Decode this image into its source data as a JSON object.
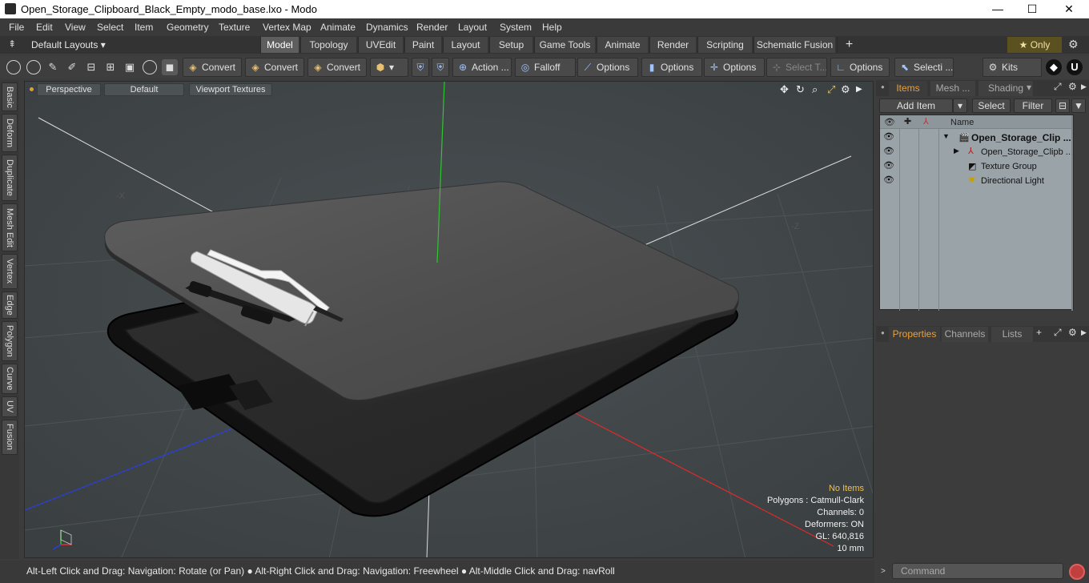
{
  "window": {
    "title": "Open_Storage_Clipboard_Black_Empty_modo_base.lxo - Modo",
    "minimize": "—",
    "maximize": "☐",
    "close": "✕"
  },
  "menu": [
    "File",
    "Edit",
    "View",
    "Select",
    "Item",
    "Geometry",
    "Texture",
    "Vertex Map",
    "Animate",
    "Dynamics",
    "Render",
    "Layout",
    "System",
    "Help"
  ],
  "layouts": {
    "label": "Default Layouts ▾",
    "tabs": [
      "Model",
      "Topology",
      "UVEdit",
      "Paint",
      "Layout",
      "Setup",
      "Game Tools",
      "Animate",
      "Render",
      "Scripting",
      "Schematic Fusion"
    ],
    "active_tab": "Model",
    "add": "+",
    "only_label": "★  Only"
  },
  "toolbar": {
    "convert_1": "Convert",
    "convert_2": "Convert",
    "convert_3": "Convert",
    "action": "Action ...",
    "falloff": "Falloff",
    "options_1": "Options",
    "options_2": "Options",
    "options_3": "Options",
    "select_t": "Select T...",
    "options_4": "Options",
    "selecti": "Selecti ...",
    "kits": "Kits"
  },
  "left_tabs": [
    "Basic",
    "Deform",
    "Duplicate",
    "Mesh Edit",
    "Vertex",
    "Edge",
    "Polygon",
    "Curve",
    "UV",
    "Fusion"
  ],
  "viewport": {
    "perspective": "Perspective",
    "default": "Default",
    "textures": "Viewport Textures",
    "axis_neg_x": "-X",
    "axis_neg_z": "-Z",
    "stats": {
      "no_items": "No Items",
      "polygons": "Polygons : Catmull-Clark",
      "channels": "Channels: 0",
      "deformers": "Deformers: ON",
      "gl": "GL: 640,816",
      "scale": "10 mm"
    }
  },
  "status": "Alt-Left Click and Drag: Navigation: Rotate (or Pan) ● Alt-Right Click and Drag: Navigation: Freewheel ● Alt-Middle Click and Drag: navRoll",
  "items_panel": {
    "tabs": [
      "Items",
      "Mesh ...",
      "Shading"
    ],
    "active_tab": "Items",
    "add_item": "Add Item",
    "select": "Select",
    "filter": "Filter",
    "name_header": "Name",
    "rows": [
      {
        "label": "Open_Storage_Clip ..."
      },
      {
        "label": "Open_Storage_Clipb ..."
      },
      {
        "label": "Texture Group"
      },
      {
        "label": "Directional Light"
      }
    ]
  },
  "properties_panel": {
    "tabs": [
      "Properties",
      "Channels",
      "Lists"
    ],
    "active_tab": "Properties",
    "add": "+"
  },
  "command": {
    "placeholder": "Command"
  }
}
